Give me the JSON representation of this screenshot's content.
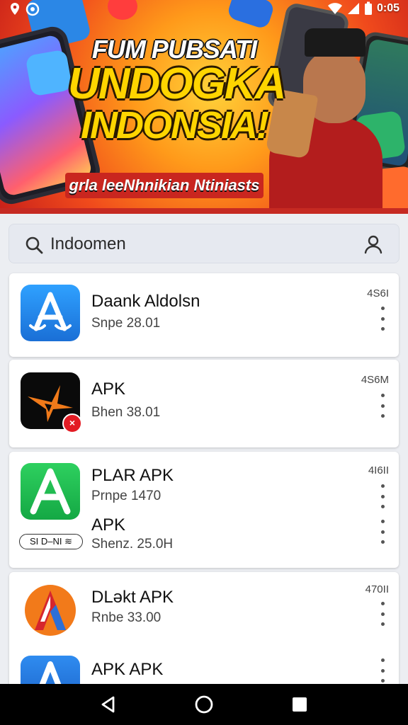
{
  "status_bar": {
    "time": "0:05"
  },
  "banner": {
    "headline_line1": "FUM PUBSATI",
    "headline_line2": "UNDOGKA",
    "headline_line3": "INDONSIA!",
    "tagline": "grla leeNhnikian Ntiniasts"
  },
  "search": {
    "value": "Indoomen"
  },
  "apps": [
    {
      "title": "Daank Aldolsn",
      "subtitle": "Snpe 28.01",
      "number": "4S6I"
    },
    {
      "title": "APK",
      "subtitle": "Bhen 38.01",
      "number": "4S6M"
    },
    {
      "title": "PLAR APK",
      "subtitle": "Prnpe 1470",
      "number": "4I6II",
      "title2": "APK",
      "subtitle2": "Shenz. 25.0H",
      "badge": "SI D–NI ≋"
    },
    {
      "title": "DLəkt APK",
      "subtitle": "Rnbe 33.00",
      "number": "470II",
      "title2": "APK APK"
    }
  ],
  "colors": {
    "banner_red": "#c62a22",
    "headline_yellow": "#ffd500",
    "search_bg": "#e6e9f0",
    "card_bg": "#ffffff",
    "navbar_bg": "#000000"
  },
  "icons": [
    "location-icon",
    "notification-icon",
    "wifi-icon",
    "signal-icon",
    "battery-icon",
    "search-icon",
    "user-icon",
    "overflow-menu-icon",
    "back-icon",
    "home-icon",
    "recents-icon"
  ]
}
